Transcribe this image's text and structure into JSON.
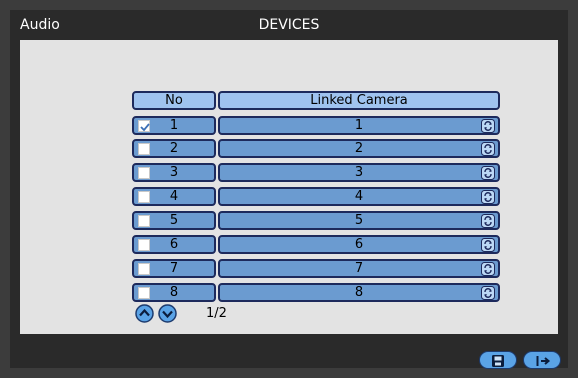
{
  "header": {
    "tab_title": "Audio",
    "page_title": "DEVICES"
  },
  "table": {
    "columns": [
      "No",
      "Linked Camera"
    ],
    "rows": [
      {
        "no": "1",
        "camera": "1",
        "checked": true
      },
      {
        "no": "2",
        "camera": "2",
        "checked": false
      },
      {
        "no": "3",
        "camera": "3",
        "checked": false
      },
      {
        "no": "4",
        "camera": "4",
        "checked": false
      },
      {
        "no": "5",
        "camera": "5",
        "checked": false
      },
      {
        "no": "6",
        "camera": "6",
        "checked": false
      },
      {
        "no": "7",
        "camera": "7",
        "checked": false
      },
      {
        "no": "8",
        "camera": "8",
        "checked": false
      }
    ]
  },
  "pager": {
    "indicator": "1/2",
    "up_icon": "arrow-up-circle-icon",
    "down_icon": "arrow-down-circle-icon"
  },
  "footer": {
    "save_icon": "save-icon",
    "exit_icon": "exit-icon"
  },
  "colors": {
    "row_fill": "#6b9bd0",
    "header_fill": "#9fc3ef",
    "button_fill": "#5aa3e6",
    "panel": "#e3e3e3"
  }
}
